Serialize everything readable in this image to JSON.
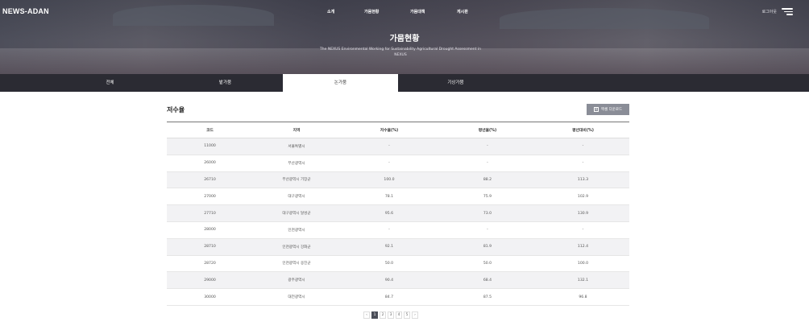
{
  "header": {
    "logo": "NEWS-ADAN",
    "nav": [
      "소개",
      "가뭄현황",
      "가뭄대책",
      "게시판"
    ],
    "login": "로그아웃",
    "title": "가뭄현황",
    "subtitle": "The NEXUS Environmental Working for Sustainability Agricultural Drought Assessment in NEXUS"
  },
  "tabs": [
    "전체",
    "밭가뭄",
    "논가뭄",
    "기상가뭄"
  ],
  "active_tab": 2,
  "section": {
    "title": "저수율",
    "excel_button": "엑셀 다운로드",
    "excel_icon": "excel-icon"
  },
  "table": {
    "headers": [
      "코드",
      "지역",
      "저수율(%)",
      "평년율(%)",
      "평년대비(%)"
    ],
    "rows": [
      [
        "11000",
        "서울특별시",
        "-",
        "-",
        "-"
      ],
      [
        "26000",
        "부산광역시",
        "-",
        "-",
        "-"
      ],
      [
        "26710",
        "부산광역시 기장군",
        "100.0",
        "88.2",
        "113.3"
      ],
      [
        "27000",
        "대구광역시",
        "78.1",
        "75.9",
        "102.9"
      ],
      [
        "27710",
        "대구광역시 달성군",
        "95.6",
        "73.0",
        "130.9"
      ],
      [
        "28000",
        "인천광역시",
        "-",
        "-",
        "-"
      ],
      [
        "28710",
        "인천광역시 강화군",
        "92.1",
        "81.9",
        "112.4"
      ],
      [
        "28720",
        "인천광역시 옹진군",
        "50.0",
        "50.0",
        "100.0"
      ],
      [
        "29000",
        "광주광역시",
        "90.4",
        "68.4",
        "132.1"
      ],
      [
        "30000",
        "대전광역시",
        "84.7",
        "87.5",
        "96.8"
      ]
    ]
  },
  "pagination": {
    "prev": "‹",
    "pages": [
      "1",
      "2",
      "3",
      "4",
      "5"
    ],
    "current": "1",
    "next": "›"
  }
}
